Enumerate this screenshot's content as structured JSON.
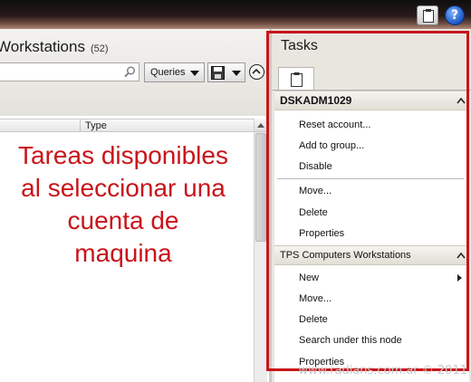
{
  "toolbar": {
    "clipboard_icon": "clipboard-icon",
    "help_icon": "help-icon",
    "help_glyph": "?"
  },
  "left_pane": {
    "title": "Workstations",
    "count": "(52)",
    "search_placeholder": "",
    "queries_label": "Queries",
    "column_type": "Type"
  },
  "annotation": {
    "line1": "Tareas disponibles",
    "line2": "al seleccionar una",
    "line3": "cuenta de",
    "line4": "maquina",
    "color": "#c8151b"
  },
  "tasks": {
    "title": "Tasks",
    "group1": {
      "header": "DSKADM1029",
      "items": [
        "Reset account...",
        "Add to group...",
        "Disable",
        "Move...",
        "Delete",
        "Properties"
      ]
    },
    "group2": {
      "header": "TPS Computers Workstations",
      "items": [
        "New",
        "Move...",
        "Delete",
        "Search under this node",
        "Properties"
      ]
    }
  },
  "watermark": "www.radians.com.ar © 2011",
  "colors": {
    "highlight": "#c8151b",
    "help_blue": "#1a56c4"
  }
}
